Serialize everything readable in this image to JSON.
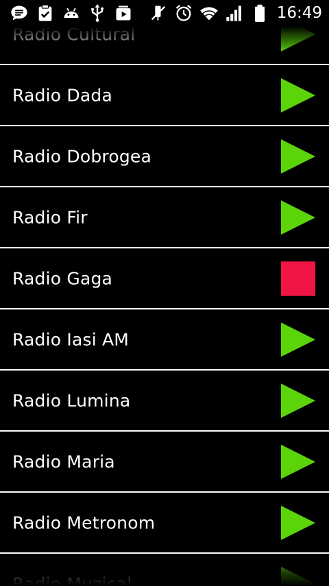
{
  "status_bar": {
    "time": "16:49",
    "left_icons": [
      "message-icon",
      "clipboard-check-icon",
      "android-icon",
      "usb-icon",
      "media-icon"
    ],
    "right_icons": [
      "mute-icon",
      "alarm-icon",
      "wifi-icon",
      "signal-icon",
      "battery-icon"
    ]
  },
  "stations": [
    {
      "name": "Radio Cultural",
      "state": "play"
    },
    {
      "name": "Radio Dada",
      "state": "play"
    },
    {
      "name": "Radio Dobrogea",
      "state": "play"
    },
    {
      "name": "Radio Fir",
      "state": "play"
    },
    {
      "name": "Radio Gaga",
      "state": "stop"
    },
    {
      "name": "Radio Iasi AM",
      "state": "play"
    },
    {
      "name": "Radio Lumina",
      "state": "play"
    },
    {
      "name": "Radio Maria",
      "state": "play"
    },
    {
      "name": "Radio Metronom",
      "state": "play"
    },
    {
      "name": "Radio Muzical",
      "state": "play"
    }
  ],
  "colors": {
    "play": "#5bd50a",
    "stop": "#f01544",
    "background": "#000000",
    "divider": "#ffffff"
  }
}
